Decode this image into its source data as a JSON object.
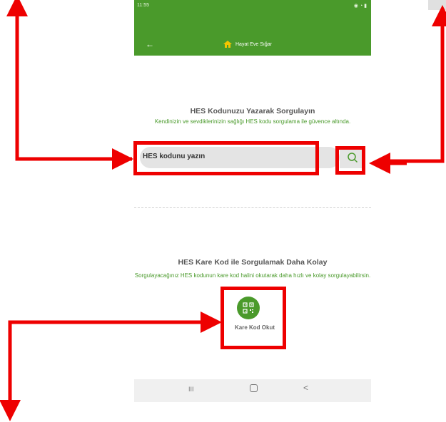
{
  "status_bar": {
    "time": "11:55",
    "icons_right": "◉ ◔ ▮"
  },
  "app_bar": {
    "title": "Hayat Eve Sığar",
    "back_icon": "←",
    "logo_icon": "house-logo-icon"
  },
  "section1": {
    "title": "HES Kodunuzu Yazarak Sorgulayın",
    "subtitle": "Kendinizin ve sevdiklerinizin sağlığı HES kodu sorgulama ile güvence altında."
  },
  "search": {
    "placeholder": "HES kodunu yazın",
    "button_icon": "search-icon"
  },
  "section2": {
    "title": "HES Kare Kod ile Sorgulamak Daha Kolay",
    "subtitle": "Sorgulayacağınız HES kodunun kare kod halini okutarak daha hızlı ve kolay sorgulayabilirsin."
  },
  "qr_button": {
    "label": "Kare Kod Okut",
    "icon": "qr-code-icon"
  },
  "nav_bar": {
    "recent": "III",
    "home": "home-icon",
    "back": "<"
  },
  "colors": {
    "brand_green": "#4a9a2b",
    "annotation_red": "#ee0000"
  }
}
